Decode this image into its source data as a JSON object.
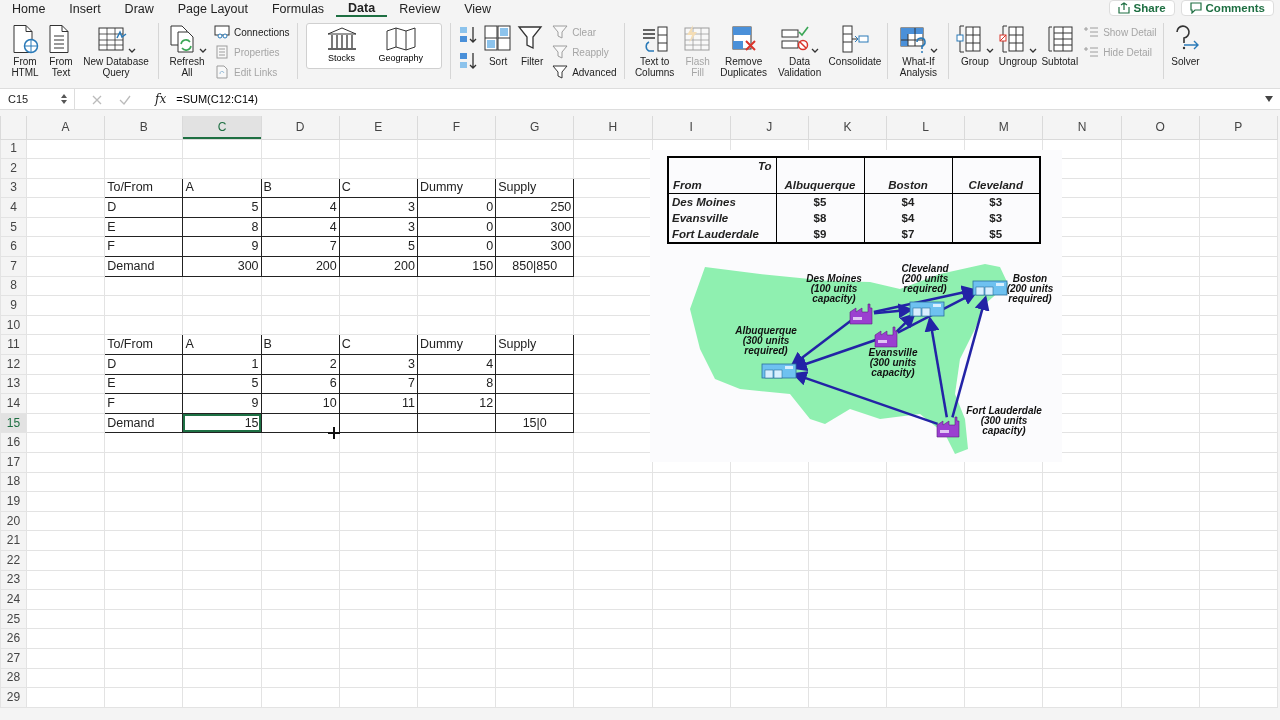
{
  "menu_tabs": [
    {
      "label": "Home",
      "selected": false
    },
    {
      "label": "Insert",
      "selected": false
    },
    {
      "label": "Draw",
      "selected": false
    },
    {
      "label": "Page Layout",
      "selected": false
    },
    {
      "label": "Formulas",
      "selected": false
    },
    {
      "label": "Data",
      "selected": true
    },
    {
      "label": "Review",
      "selected": false
    },
    {
      "label": "View",
      "selected": false
    }
  ],
  "header_buttons": [
    {
      "label": "Share"
    },
    {
      "label": "Comments"
    }
  ],
  "ribbon": [
    {
      "kind": "buttons",
      "items": [
        {
          "kind": "large",
          "label": "From HTML",
          "disabled": false,
          "dropdown": false
        },
        {
          "kind": "large",
          "label": "From Text",
          "disabled": false,
          "dropdown": false
        },
        {
          "kind": "large",
          "label": "New Database Query",
          "disabled": false,
          "dropdown": true
        }
      ]
    },
    {
      "kind": "buttons",
      "items": [
        {
          "kind": "large",
          "label": "Refresh All",
          "disabled": false,
          "dropdown": true
        },
        {
          "kind": "small",
          "label": "Connections",
          "disabled": false,
          "dropdown": false
        },
        {
          "kind": "small",
          "label": "Properties",
          "disabled": true,
          "dropdown": false
        },
        {
          "kind": "small",
          "label": "Edit Links",
          "disabled": true,
          "dropdown": false
        }
      ]
    },
    {
      "kind": "gallery",
      "items": [
        {
          "label": "Stocks"
        },
        {
          "label": "Geography"
        }
      ]
    },
    {
      "kind": "buttons",
      "items": [
        {
          "kind": "icon",
          "disabled": false
        },
        {
          "kind": "icon",
          "disabled": false
        },
        {
          "kind": "large",
          "label": "Sort",
          "disabled": false,
          "dropdown": false
        },
        {
          "kind": "large",
          "label": "Filter",
          "disabled": false,
          "dropdown": false
        },
        {
          "kind": "small",
          "label": "Clear",
          "disabled": true,
          "dropdown": false
        },
        {
          "kind": "small",
          "label": "Reapply",
          "disabled": true,
          "dropdown": false
        },
        {
          "kind": "small",
          "label": "Advanced",
          "disabled": false,
          "dropdown": false
        }
      ]
    },
    {
      "kind": "buttons",
      "items": [
        {
          "kind": "large",
          "label": "Text to Columns",
          "disabled": false,
          "dropdown": false
        },
        {
          "kind": "large",
          "label": "Flash Fill",
          "disabled": true,
          "dropdown": false
        },
        {
          "kind": "large",
          "label": "Remove Duplicates",
          "disabled": false,
          "dropdown": false
        },
        {
          "kind": "large",
          "label": "Data Validation",
          "disabled": false,
          "dropdown": true
        },
        {
          "kind": "large",
          "label": "Consolidate",
          "disabled": false,
          "dropdown": false
        }
      ]
    },
    {
      "kind": "buttons",
      "items": [
        {
          "kind": "large",
          "label": "What-If Analysis",
          "disabled": false,
          "dropdown": true
        }
      ]
    },
    {
      "kind": "buttons",
      "items": [
        {
          "kind": "large",
          "label": "Group",
          "disabled": false,
          "dropdown": true
        },
        {
          "kind": "large",
          "label": "Ungroup",
          "disabled": false,
          "dropdown": true
        },
        {
          "kind": "large",
          "label": "Subtotal",
          "disabled": false,
          "dropdown": false
        },
        {
          "kind": "small",
          "label": "Show Detail",
          "disabled": true,
          "dropdown": false
        },
        {
          "kind": "small",
          "label": "Hide Detail",
          "disabled": true,
          "dropdown": false
        }
      ]
    },
    {
      "kind": "buttons",
      "items": [
        {
          "kind": "large",
          "label": "Solver",
          "disabled": false,
          "dropdown": false
        }
      ]
    }
  ],
  "formula_bar": {
    "name_box": "C15",
    "function_label": "fx",
    "formula": "=SUM(C12:C14)"
  },
  "columns": [
    {
      "label": "A",
      "selected": false
    },
    {
      "label": "B",
      "selected": false
    },
    {
      "label": "C",
      "selected": true
    },
    {
      "label": "D",
      "selected": false
    },
    {
      "label": "E",
      "selected": false
    },
    {
      "label": "F",
      "selected": false
    },
    {
      "label": "G",
      "selected": false
    },
    {
      "label": "H",
      "selected": false
    },
    {
      "label": "I",
      "selected": false
    },
    {
      "label": "J",
      "selected": false
    },
    {
      "label": "K",
      "selected": false
    },
    {
      "label": "L",
      "selected": false
    },
    {
      "label": "M",
      "selected": false
    },
    {
      "label": "N",
      "selected": false
    },
    {
      "label": "O",
      "selected": false
    },
    {
      "label": "P",
      "selected": false
    }
  ],
  "rows": [
    {
      "label": "1",
      "selected": false
    },
    {
      "label": "2",
      "selected": false
    },
    {
      "label": "3",
      "selected": false
    },
    {
      "label": "4",
      "selected": false
    },
    {
      "label": "5",
      "selected": false
    },
    {
      "label": "6",
      "selected": false
    },
    {
      "label": "7",
      "selected": false
    },
    {
      "label": "8",
      "selected": false
    },
    {
      "label": "9",
      "selected": false
    },
    {
      "label": "10",
      "selected": false
    },
    {
      "label": "11",
      "selected": false
    },
    {
      "label": "12",
      "selected": false
    },
    {
      "label": "13",
      "selected": false
    },
    {
      "label": "14",
      "selected": false
    },
    {
      "label": "15",
      "selected": true
    },
    {
      "label": "16",
      "selected": false
    },
    {
      "label": "17",
      "selected": false
    },
    {
      "label": "18",
      "selected": false
    },
    {
      "label": "19",
      "selected": false
    },
    {
      "label": "20",
      "selected": false
    },
    {
      "label": "21",
      "selected": false
    },
    {
      "label": "22",
      "selected": false
    },
    {
      "label": "23",
      "selected": false
    },
    {
      "label": "24",
      "selected": false
    },
    {
      "label": "25",
      "selected": false
    },
    {
      "label": "26",
      "selected": false
    },
    {
      "label": "27",
      "selected": false
    },
    {
      "label": "28",
      "selected": false
    },
    {
      "label": "29",
      "selected": false
    }
  ],
  "sheet_tables": [
    {
      "rows": [
        {
          "kind": "header",
          "label": "To/From",
          "values": [
            "A",
            "B",
            "C",
            "Dummy"
          ],
          "last_column": "Supply"
        },
        {
          "kind": "supply",
          "label": "D",
          "values": [
            "5",
            "4",
            "3",
            "0"
          ],
          "last_column": "250"
        },
        {
          "kind": "supply",
          "label": "E",
          "values": [
            "8",
            "4",
            "3",
            "0"
          ],
          "last_column": "300"
        },
        {
          "kind": "supply",
          "label": "F",
          "values": [
            "9",
            "7",
            "5",
            "0"
          ],
          "last_column": "300"
        },
        {
          "kind": "demand",
          "label": "Demand",
          "values": [
            "300",
            "200",
            "200",
            "150"
          ],
          "last_column": "850|850"
        }
      ]
    },
    {
      "rows": [
        {
          "kind": "header",
          "label": "To/From",
          "values": [
            "A",
            "B",
            "C",
            "Dummy"
          ],
          "last_column": "Supply"
        },
        {
          "kind": "supply",
          "label": "D",
          "values": [
            "1",
            "2",
            "3",
            "4"
          ]
        },
        {
          "kind": "supply",
          "label": "E",
          "values": [
            "5",
            "6",
            "7",
            "8"
          ]
        },
        {
          "kind": "supply",
          "label": "F",
          "values": [
            "9",
            "10",
            "11",
            "12"
          ]
        },
        {
          "kind": "demand",
          "label": "Demand",
          "values": [
            "15"
          ],
          "last_column": "15|0"
        }
      ]
    }
  ],
  "embedded_picture": {
    "cost_table": {
      "to_label": "To",
      "from_label": "From",
      "columns": [
        "Albuquerque",
        "Boston",
        "Cleveland"
      ],
      "rows": [
        {
          "label": "Des Moines",
          "values": [
            "$5",
            "$4",
            "$3"
          ]
        },
        {
          "label": "Evansville",
          "values": [
            "$8",
            "$4",
            "$3"
          ]
        },
        {
          "label": "Fort Lauderdale",
          "values": [
            "$9",
            "$7",
            "$5"
          ]
        }
      ]
    },
    "map_nodes": [
      {
        "name": "Des Moines",
        "note": "(100 units capacity)",
        "kind": "factory"
      },
      {
        "name": "Cleveland",
        "note": "(200 units required)",
        "kind": "warehouse"
      },
      {
        "name": "Boston",
        "note": "(200 units required)",
        "kind": "warehouse"
      },
      {
        "name": "Albuquerque",
        "note": "(300 units required)",
        "kind": "warehouse"
      },
      {
        "name": "Evansville",
        "note": "(300 units capacity)",
        "kind": "factory"
      },
      {
        "name": "Fort Lauderdale",
        "note": "(300 units capacity)",
        "kind": "factory"
      }
    ]
  }
}
